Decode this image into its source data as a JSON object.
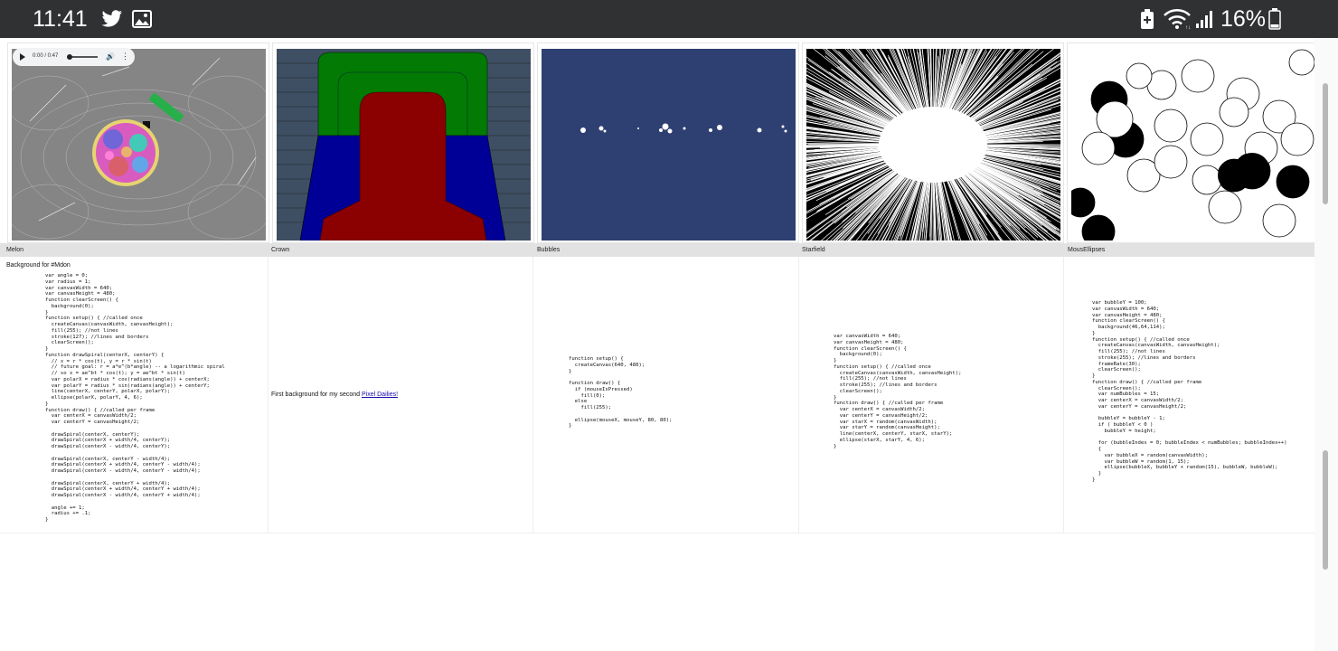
{
  "status_bar": {
    "time": "11:41",
    "battery_percent": "16%",
    "icons": [
      "twitter-icon",
      "image-icon",
      "battery-saver-icon",
      "wifi-icon",
      "signal-icon",
      "battery-icon"
    ]
  },
  "audio_player": {
    "time": "0:00 / 0:47",
    "play_icon": "play-icon",
    "volume_icon": "volume-icon",
    "more_icon": "more-vert-icon"
  },
  "sketches": [
    {
      "title": "Melon",
      "description": "Background for #Mdon",
      "code": "var angle = 0;\nvar radius = 1;\nvar canvasWidth = 640;\nvar canvasHeight = 480;\nfunction clearScreen() {\n  background(0);\n}\nfunction setup() { //called once\n  createCanvas(canvasWidth, canvasHeight);\n  fill(255); //not lines\n  stroke(127); //lines and borders\n  clearScreen();\n}\nfunction drawSpiral(centerX, centerY) {\n  // x = r * cos(t), y = r * sin(t)\n  // future goal: r = a*e^(b*angle) -- a logarithmic spiral\n  // so x = ae^bt * cos(t); y = ae^bt * sin(t)\n  var polarX = radius * cos(radians(angle)) + centerX;\n  var polarY = radius * sin(radians(angle)) + centerY;\n  line(centerX, centerY, polarX, polarY);\n  ellipse(polarX, polarY, 4, 6);\n}\nfunction draw() { //called per frame\n  var centerX = canvasWidth/2;\n  var centerY = canvasHeight/2;\n\n  drawSpiral(centerX, centerY);\n  drawSpiral(centerX + width/4, centerY);\n  drawSpiral(centerX - width/4, centerY);\n\n  drawSpiral(centerX, centerY - width/4);\n  drawSpiral(centerX + width/4, centerY - width/4);\n  drawSpiral(centerX - width/4, centerY - width/4);\n\n  drawSpiral(centerX, centerY + width/4);\n  drawSpiral(centerX + width/4, centerY + width/4);\n  drawSpiral(centerX - width/4, centerY + width/4);\n\n  angle += 1;\n  radius += .1;\n}"
    },
    {
      "title": "Crown",
      "description": "First background for my second ",
      "link_text": "Pixel Dailies!",
      "code": ""
    },
    {
      "title": "Bubbles",
      "description": "",
      "code": "function setup() {\n  createCanvas(640, 480);\n}\n\nfunction draw() {\n  if (mouseIsPressed)\n    fill(0);\n  else\n    fill(255);\n\n  ellipse(mouseX, mouseY, 80, 80);\n}"
    },
    {
      "title": "Starfield",
      "description": "",
      "code": "var canvasWidth = 640;\nvar canvasHeight = 480;\nfunction clearScreen() {\n  background(0);\n}\nfunction setup() { //called once\n  createCanvas(canvasWidth, canvasHeight);\n  fill(255); //not lines\n  stroke(255); //lines and borders\n  clearScreen();\n}\nfunction draw() { //called per frame\n  var centerX = canvasWidth/2;\n  var centerY = canvasHeight/2;\n  var starX = random(canvasWidth);\n  var starY = random(canvasHeight);\n  line(centerX, centerY, starX, starY);\n  ellipse(starX, starY, 4, 6);\n}"
    },
    {
      "title": "MousEllipses",
      "description": "",
      "code": "var bubbleY = 100;\nvar canvasWidth = 640;\nvar canvasHeight = 480;\nfunction clearScreen() {\n  background(46,64,114);\n}\nfunction setup() { //called once\n  createCanvas(canvasWidth, canvasHeight);\n  fill(255); //not lines\n  stroke(255); //lines and borders\n  frameRate(30);\n  clearScreen();\n}\nfunction draw() { //called per frame\n  clearScreen();\n  var numBubbles = 15;\n  var centerX = canvasWidth/2;\n  var centerY = canvasHeight/2;\n\n  bubbleY = bubbleY - 1;\n  if ( bubbleY < 0 )\n    bubbleY = height;\n\n  for (bubbleIndex = 0; bubbleIndex < numBubbles; bubbleIndex++)\n  {\n    var bubbleX = random(canvasWidth);\n    var bubbleW = random(1, 15);\n    ellipse(bubbleX, bubbleY + random(15), bubbleW, bubbleW);\n  }\n}"
    }
  ],
  "colors": {
    "status_bar_bg": "#303133",
    "title_row_bg": "#e2e2e2",
    "crown_bg": "#3f4f63",
    "bubbles_bg": "#2e3f72",
    "link": "#1a0dab"
  }
}
